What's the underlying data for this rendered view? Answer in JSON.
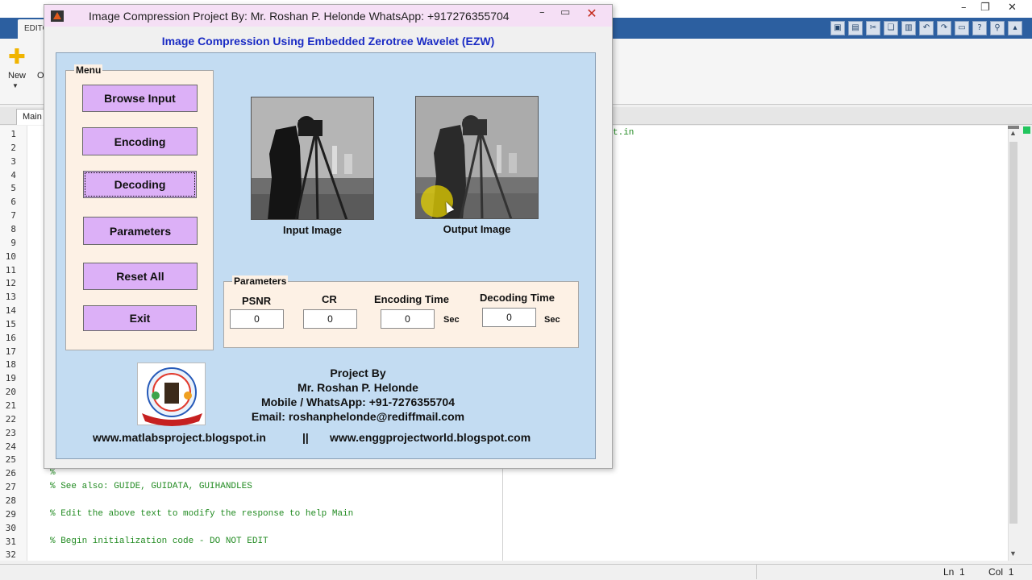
{
  "background_app": {
    "ribbon_tab": "EDITO",
    "new_label": "New",
    "open_label": "O",
    "file_tab": "Main",
    "line_numbers": [
      "1",
      "2",
      "3",
      "4",
      "5",
      "6",
      "7",
      "8",
      "9",
      "10",
      "11",
      "12",
      "13",
      "14",
      "15",
      "16",
      "17",
      "18",
      "19",
      "20",
      "21",
      "22",
      "23",
      "24",
      "25",
      "26",
      "27",
      "28",
      "29",
      "30",
      "31",
      "32"
    ],
    "code_lines": [
      {
        "line": "26",
        "text": "%"
      },
      {
        "line": "27",
        "text": "% See also: GUIDE, GUIDATA, GUIHANDLES"
      },
      {
        "line": "29",
        "text": "% Edit the above text to modify the response to help Main"
      },
      {
        "line": "31",
        "text": "% Begin initialization code - DO NOT EDIT"
      }
    ],
    "right_code_fragment": "t.in",
    "status": {
      "ln_label": "Ln",
      "ln_value": "1",
      "col_label": "Col",
      "col_value": "1"
    }
  },
  "figure_window": {
    "title": "Image Compression   Project By: Mr. Roshan P. Helonde   WhatsApp: +917276355704",
    "header": "Image Compression Using Embedded Zerotree Wavelet (EZW)",
    "menu": {
      "title": "Menu",
      "buttons": [
        "Browse Input",
        "Encoding",
        "Decoding",
        "Parameters",
        "Reset All",
        "Exit"
      ]
    },
    "images": {
      "input_caption": "Input Image",
      "output_caption": "Output Image"
    },
    "parameters": {
      "title": "Parameters",
      "psnr_label": "PSNR",
      "psnr_value": "0",
      "cr_label": "CR",
      "cr_value": "0",
      "encoding_time_label": "Encoding Time",
      "encoding_time_value": "0",
      "encoding_time_unit": "Sec",
      "decoding_time_label": "Decoding Time",
      "decoding_time_value": "0",
      "decoding_time_unit": "Sec"
    },
    "credits": {
      "line1": "Project By",
      "line2": "Mr. Roshan P. Helonde",
      "line3": "Mobile / WhatsApp: +91-7276355704",
      "line4": "Email: roshanphelonde@rediffmail.com",
      "link1": "www.matlabsproject.blogspot.in",
      "separator": "||",
      "link2": "www.enggprojectworld.blogspot.com"
    }
  },
  "colors": {
    "header_text": "#1a2bc4",
    "main_panel": "#c3dcf2",
    "panel_bg": "#fdf1e5",
    "button_bg": "#dcb0f7",
    "title_bar": "#f5dff5"
  }
}
